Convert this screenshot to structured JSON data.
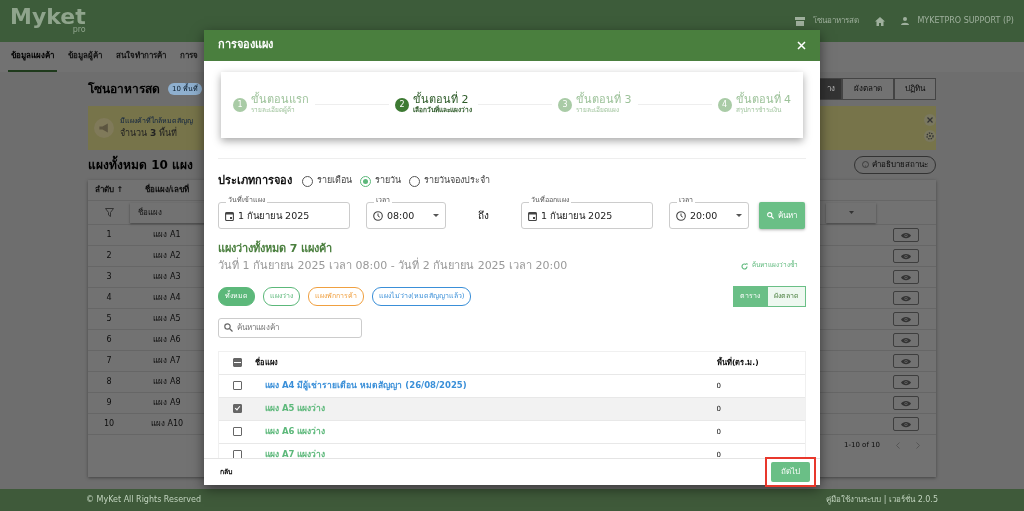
{
  "navbar": {
    "logo": "Myket",
    "logo_sub": "pro",
    "zone": "โซนอาหารสด",
    "user": "MYKETPRO SUPPORT (P)"
  },
  "tabs": [
    {
      "label": "ข้อมูลแผงค้า",
      "selected": true
    },
    {
      "label": "ข้อมูลผู้ค้า",
      "selected": false
    },
    {
      "label": "สนใจทำการค้า",
      "selected": false
    },
    {
      "label": "การจ",
      "selected": false
    }
  ],
  "zone": {
    "title": "โซนอาหารสด",
    "badge": "10 พื้นที่"
  },
  "view_buttons": [
    {
      "label": "าง",
      "selected": true
    },
    {
      "label": "ผังตลาด",
      "selected": false
    },
    {
      "label": "ปฏิทิน",
      "selected": false
    }
  ],
  "alert": {
    "text": "มีแผงค้าที่ใกล้หมดสัญญ",
    "count_text": "จำนวน **3** พื้นที่"
  },
  "stalls_heading": "แผงทั้งหมด 10 แผง",
  "status_legend": "คำอธิบายสถานะ",
  "table": {
    "columns": [
      "ลำดับ ↑",
      "ชื่อแผง/เลขที่"
    ],
    "filter_placeholder": "ชื่อแผง",
    "pagination": "1-10 of 10",
    "rows": [
      {
        "index": "1",
        "name": "แผง A1"
      },
      {
        "index": "2",
        "name": "แผง A2"
      },
      {
        "index": "3",
        "name": "แผง A3"
      },
      {
        "index": "4",
        "name": "แผง A4"
      },
      {
        "index": "5",
        "name": "แผง A5"
      },
      {
        "index": "6",
        "name": "แผง A6"
      },
      {
        "index": "7",
        "name": "แผง A7"
      },
      {
        "index": "8",
        "name": "แผง A8"
      },
      {
        "index": "9",
        "name": "แผง A9"
      },
      {
        "index": "10",
        "name": "แผง A10"
      }
    ]
  },
  "footer": {
    "left": "© MyKet All Rights Reserved",
    "right": "คู่มือใช้งานระบบ | เวอร์ชั่น 2.0.5"
  },
  "modal": {
    "title": "การจองแผง",
    "steps": [
      {
        "number": "1",
        "title": "ขั้นตอนแรก",
        "subtitle": "รายละเอียดผู้ค้า",
        "selected": false
      },
      {
        "number": "2",
        "title": "ขั้นตอนที่ 2",
        "subtitle": "เลือกวันที่และแผงว่าง",
        "selected": true
      },
      {
        "number": "3",
        "title": "ขั้นตอนที่ 3",
        "subtitle": "รายละเอียดแผง",
        "selected": false
      },
      {
        "number": "4",
        "title": "ขั้นตอนที่ 4",
        "subtitle": "สรุปการชำระเงิน",
        "selected": false
      }
    ],
    "booking_type": {
      "label": "ประเภทการจอง",
      "options": [
        {
          "label": "รายเดือน",
          "selected": false
        },
        {
          "label": "รายวัน",
          "selected": true
        },
        {
          "label": "รายวันจองประจำ",
          "selected": false
        }
      ]
    },
    "start_date": {
      "label": "วันที่เข้าแผง",
      "value": "1 กันยายน 2025"
    },
    "start_time": {
      "label": "เวลา",
      "value": "08:00"
    },
    "to": "ถึง",
    "end_date": {
      "label": "วันที่ออกแผง",
      "value": "1 กันยายน 2025"
    },
    "end_time": {
      "label": "เวลา",
      "value": "20:00"
    },
    "search_button": "ค้นหา",
    "result_title": "แผงว่างทั้งหมด 7 แผงค้า",
    "result_range": "วันที่ 1 กันยายน 2025 เวลา 08:00 - วันที่ 2 กันยายน 2025 เวลา 20:00",
    "research": "ค้นหาแผงว่างซ้ำ",
    "filters": [
      {
        "label": "ทั้งหมด",
        "selected": true,
        "color": "#5cb87a"
      },
      {
        "label": "แผงว่าง",
        "selected": false,
        "color": "#5cb87a"
      },
      {
        "label": "แผงพักการค้า",
        "selected": false,
        "color": "#f0a040"
      },
      {
        "label": "แผงไม่ว่าง(หมดสัญญาแล้ว)",
        "selected": false,
        "color": "#3a8fd8"
      }
    ],
    "view_toggle": [
      {
        "label": "ตาราง",
        "selected": true
      },
      {
        "label": "ผังตลาด",
        "selected": false
      }
    ],
    "search_placeholder": "ค้นหาแผงค้า",
    "table": {
      "columns": [
        "ชื่อแผง",
        "พื้นที่(ตร.ม.)"
      ],
      "select_all_indeterminate": true,
      "rows": [
        {
          "name": "แผง A4 มีผู้เช่ารายเดือน หมดสัญญา (26/08/2025)",
          "area": "0",
          "checked": false,
          "color": "#3a8fd8"
        },
        {
          "name": "แผง A5 แผงว่าง",
          "area": "0",
          "checked": true,
          "color": "#5cb87a"
        },
        {
          "name": "แผง A6 แผงว่าง",
          "area": "0",
          "checked": false,
          "color": "#5cb87a"
        },
        {
          "name": "แผง A7 แผงว่าง",
          "area": "0",
          "checked": false,
          "color": "#5cb87a"
        }
      ]
    },
    "back": "กลับ",
    "next": "ถัดไป",
    "next_highlighted": true
  }
}
